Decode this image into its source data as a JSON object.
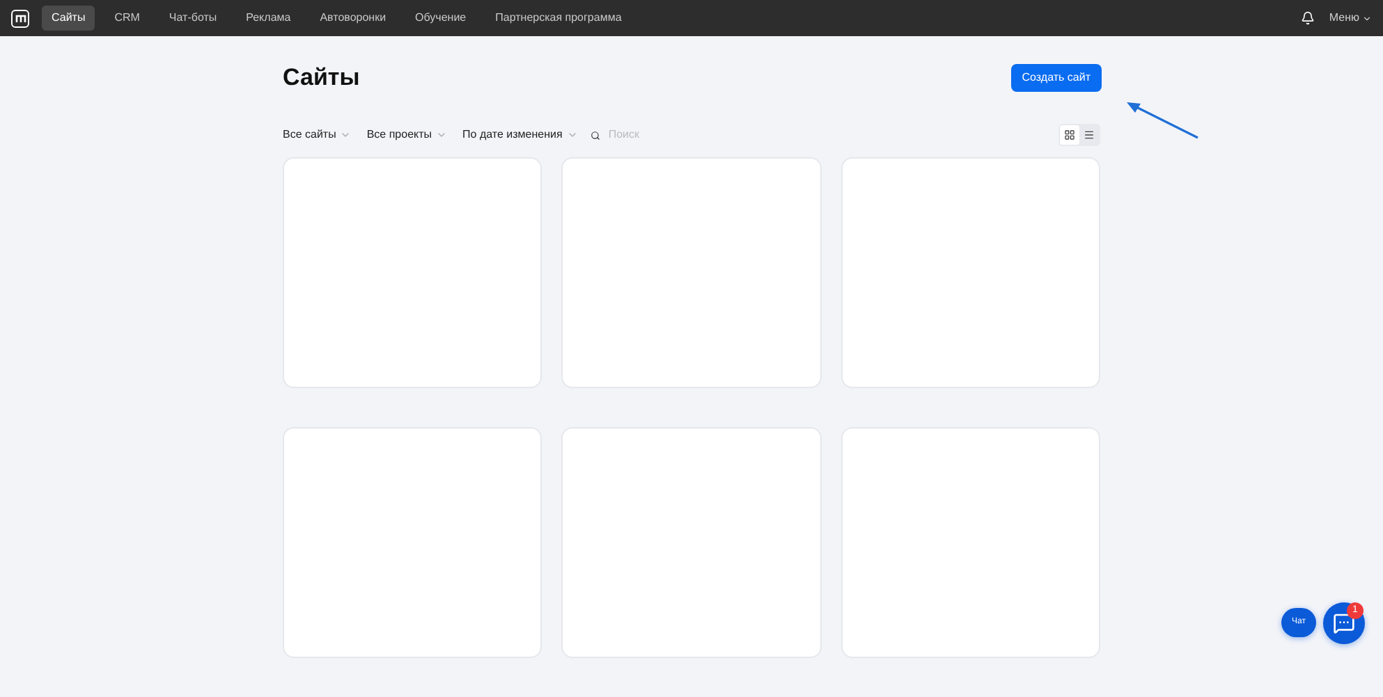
{
  "nav": {
    "tabs": [
      {
        "label": "Сайты",
        "selected": true
      },
      {
        "label": "CRM",
        "selected": false
      },
      {
        "label": "Чат-боты",
        "selected": false
      },
      {
        "label": "Реклама",
        "selected": false
      },
      {
        "label": "Автоворонки",
        "selected": false
      },
      {
        "label": "Обучение",
        "selected": false
      },
      {
        "label": "Партнерская программа",
        "selected": false
      }
    ],
    "menu": "Меню"
  },
  "page": {
    "title": "Сайты",
    "create_button": "Создать сайт"
  },
  "filters": [
    {
      "label": "Все сайты"
    },
    {
      "label": "Все проекты"
    },
    {
      "label": "По дате изменения"
    }
  ],
  "search": {
    "placeholder": "Поиск"
  },
  "view_toggle": [
    {
      "kind": "grid",
      "selected": true
    },
    {
      "kind": "list",
      "selected": false
    }
  ],
  "cards": [
    {
      "kind": "blank"
    },
    {
      "kind": "blank"
    },
    {
      "kind": "blank"
    },
    {
      "kind": "blank"
    },
    {
      "kind": "blank"
    },
    {
      "kind": "blank"
    }
  ],
  "chat": {
    "label": "Чат",
    "badge": "1"
  }
}
